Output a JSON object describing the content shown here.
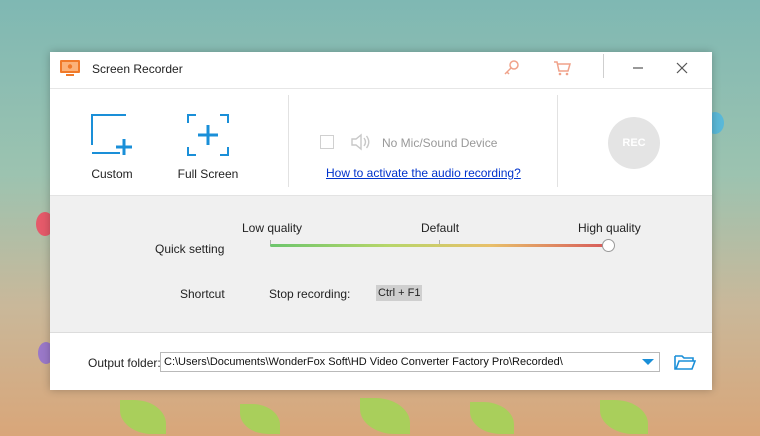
{
  "window": {
    "title": "Screen Recorder"
  },
  "titlebar_icons": [
    "monitor-app-icon",
    "key-icon",
    "cart-icon",
    "minimize-icon",
    "close-icon"
  ],
  "modes": [
    {
      "label": "Custom",
      "icon": "custom-region-icon"
    },
    {
      "label": "Full Screen",
      "icon": "full-screen-icon"
    }
  ],
  "audio": {
    "device_text": "No Mic/Sound Device",
    "help_link": "How to activate the audio recording?"
  },
  "rec_button": {
    "label": "REC"
  },
  "quality": {
    "quick_setting_label": "Quick setting",
    "levels": [
      "Low quality",
      "Default",
      "High quality"
    ],
    "selected": "High quality",
    "value_fraction": 1.0
  },
  "shortcut": {
    "label": "Shortcut",
    "stop_label": "Stop recording:",
    "stop_key": "Ctrl + F1"
  },
  "output": {
    "label": "Output folder:",
    "path": "C:\\Users\\Documents\\WonderFox Soft\\HD Video Converter Factory Pro\\Recorded\\"
  },
  "colors": {
    "accent": "#1a8fd8",
    "title_icon_orange": "#f07a2a",
    "disabled_rec": "#e4e4e4",
    "link": "#0033cc"
  }
}
